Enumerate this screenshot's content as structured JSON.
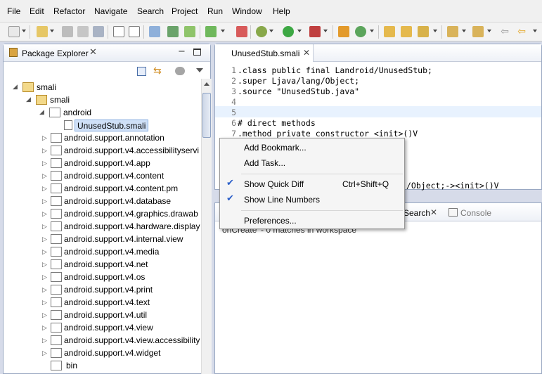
{
  "menu": [
    "File",
    "Edit",
    "Refactor",
    "Navigate",
    "Search",
    "Project",
    "Run",
    "Window",
    "Help"
  ],
  "explorer": {
    "title": "Package Explorer",
    "items": [
      {
        "label": "smali"
      },
      {
        "label": "smali"
      },
      {
        "label": "android"
      },
      {
        "label": "UnusedStub.smali"
      },
      {
        "label": "android.support.annotation"
      },
      {
        "label": "android.support.v4.accessibilityservi"
      },
      {
        "label": "android.support.v4.app"
      },
      {
        "label": "android.support.v4.content"
      },
      {
        "label": "android.support.v4.content.pm"
      },
      {
        "label": "android.support.v4.database"
      },
      {
        "label": "android.support.v4.graphics.drawab"
      },
      {
        "label": "android.support.v4.hardware.display"
      },
      {
        "label": "android.support.v4.internal.view"
      },
      {
        "label": "android.support.v4.media"
      },
      {
        "label": "android.support.v4.net"
      },
      {
        "label": "android.support.v4.os"
      },
      {
        "label": "android.support.v4.print"
      },
      {
        "label": "android.support.v4.text"
      },
      {
        "label": "android.support.v4.util"
      },
      {
        "label": "android.support.v4.view"
      },
      {
        "label": "android.support.v4.view.accessibility"
      },
      {
        "label": "android.support.v4.widget"
      },
      {
        "label": "bin"
      }
    ]
  },
  "editor": {
    "tab": "UnusedStub.smali",
    "lines": [
      {
        "n": "1",
        "text": ".class public final Landroid/UnusedStub;"
      },
      {
        "n": "2",
        "text": ".super Ljava/lang/Object;"
      },
      {
        "n": "3",
        "text": ".source \"UnusedStub.java\""
      },
      {
        "n": "4",
        "text": ""
      },
      {
        "n": "5",
        "text": ""
      },
      {
        "n": "6",
        "text": "# direct methods"
      },
      {
        "n": "7",
        "text": ".method private constructor <init>()V"
      }
    ],
    "partial_line": "/Object;-><init>()V"
  },
  "bottom": {
    "search_tab": "Search",
    "console_tab": "Console",
    "status_text": "onCreate' - 0 matches in workspace"
  },
  "context_menu": {
    "items": [
      {
        "label": "Add Bookmark...",
        "shortcut": "",
        "checked": false
      },
      {
        "label": "Add Task...",
        "shortcut": "",
        "checked": false
      },
      {
        "label": "Show Quick Diff",
        "shortcut": "Ctrl+Shift+Q",
        "checked": true
      },
      {
        "label": "Show Line Numbers",
        "shortcut": "",
        "checked": true
      },
      {
        "label": "Preferences...",
        "shortcut": "",
        "checked": false
      }
    ]
  },
  "colors": {
    "accent": "#2a5ec9",
    "selection": "#cfe0f7",
    "current_line": "#e8f2fe"
  }
}
